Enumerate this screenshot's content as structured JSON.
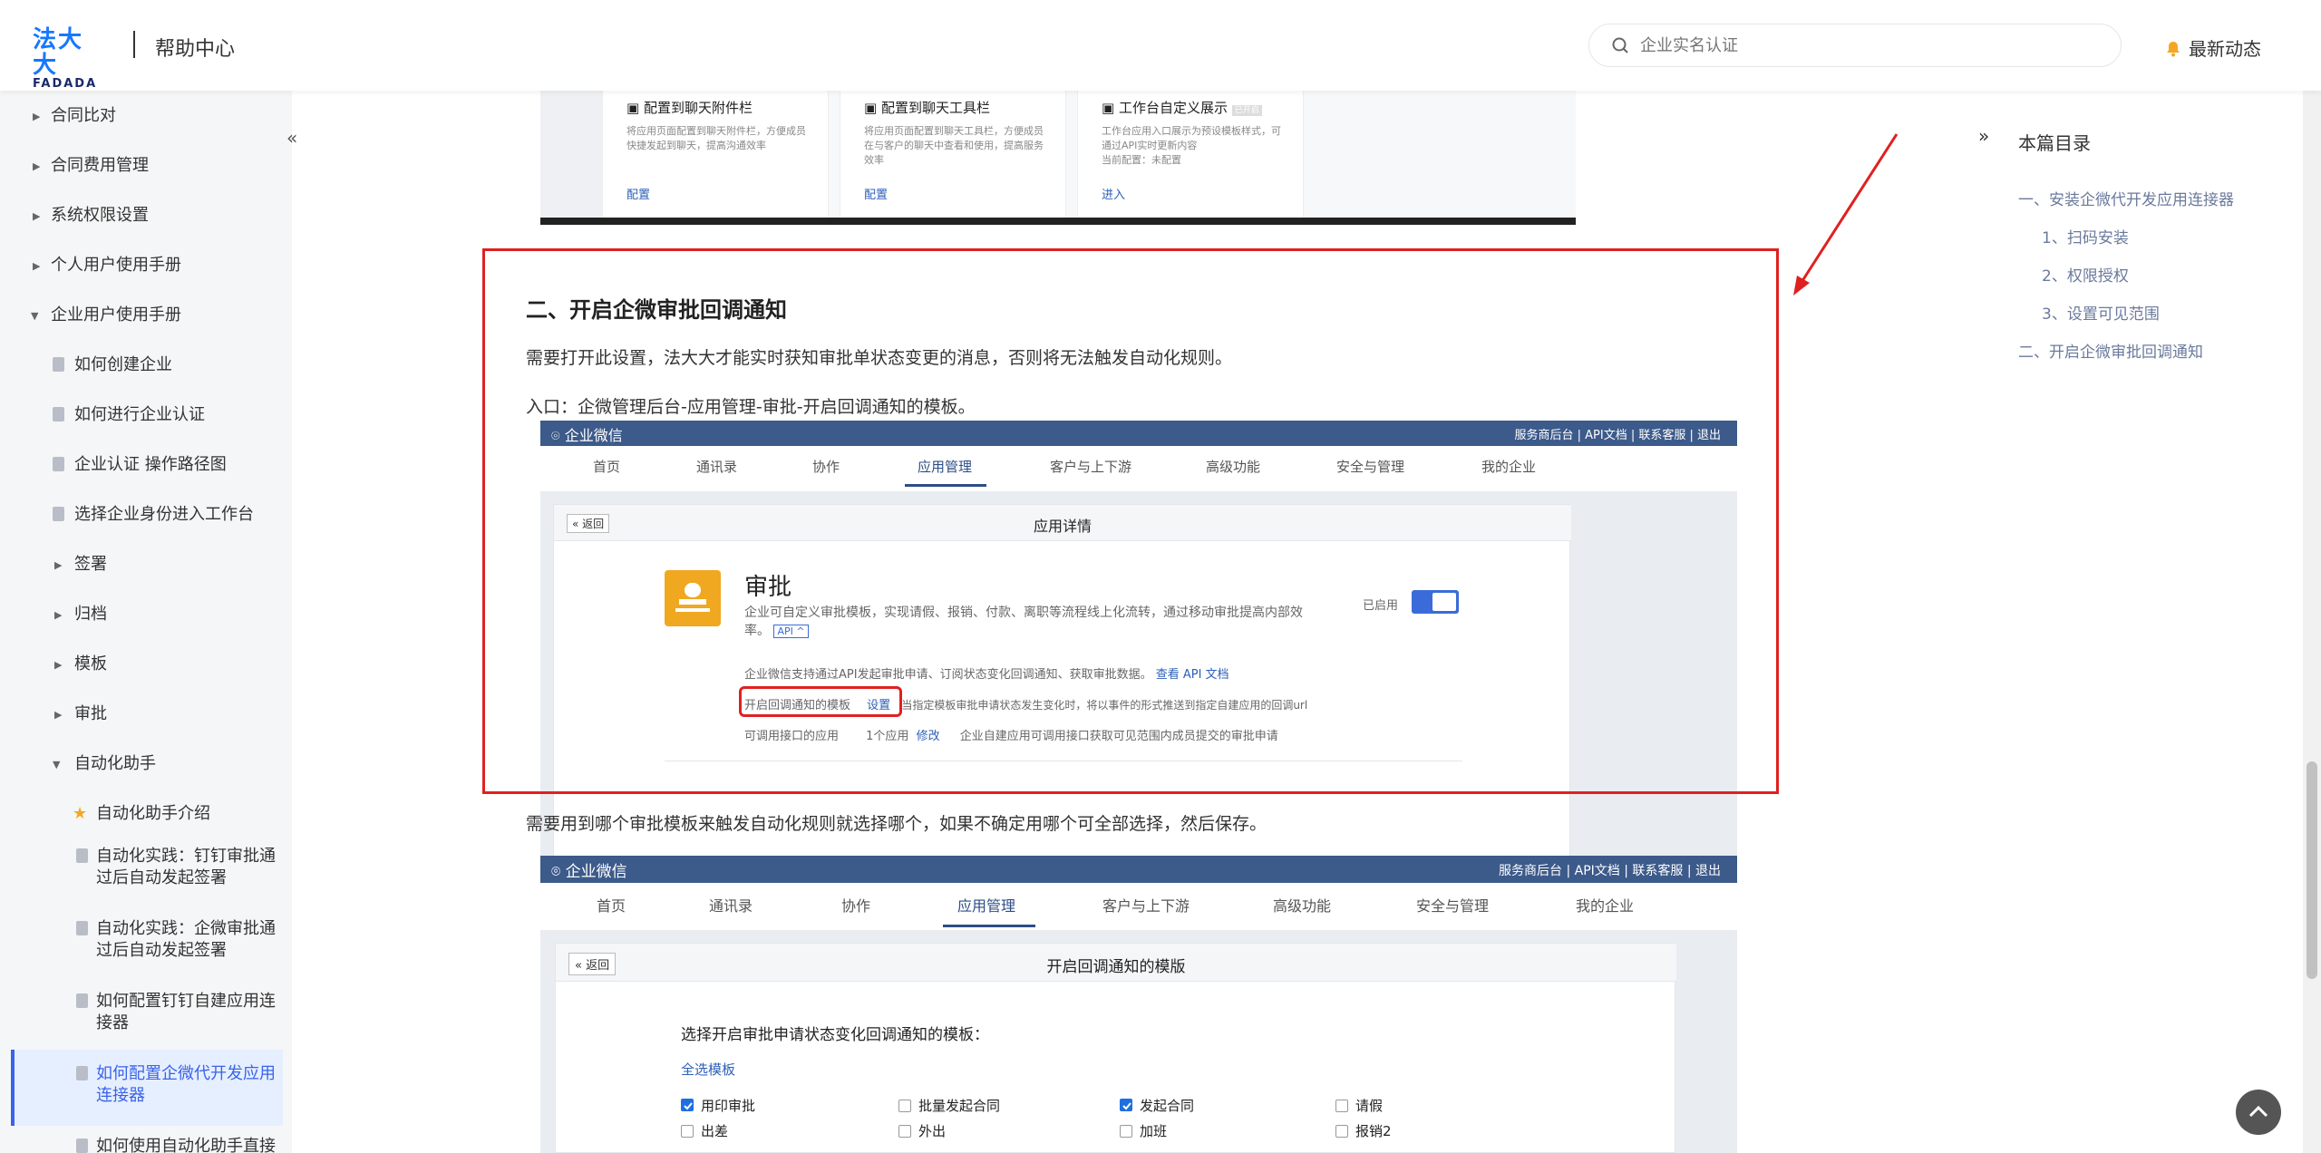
{
  "header": {
    "logo_cn": "法大大",
    "logo_en": "FADADA",
    "section": "帮助中心",
    "search_placeholder": "企业实名认证",
    "news": "最新动态"
  },
  "sidebar": {
    "items": [
      {
        "label": "合同比对",
        "type": "folder"
      },
      {
        "label": "合同费用管理",
        "type": "folder"
      },
      {
        "label": "系统权限设置",
        "type": "folder"
      },
      {
        "label": "个人用户使用手册",
        "type": "folder"
      },
      {
        "label": "企业用户使用手册",
        "type": "folder-open"
      },
      {
        "label": "如何创建企业",
        "type": "doc"
      },
      {
        "label": "如何进行企业认证",
        "type": "doc"
      },
      {
        "label": "企业认证 操作路径图",
        "type": "doc"
      },
      {
        "label": "选择企业身份进入工作台",
        "type": "doc"
      },
      {
        "label": "签署",
        "type": "sub-folder"
      },
      {
        "label": "归档",
        "type": "sub-folder"
      },
      {
        "label": "模板",
        "type": "sub-folder"
      },
      {
        "label": "审批",
        "type": "sub-folder"
      },
      {
        "label": "自动化助手",
        "type": "sub-folder-open"
      },
      {
        "label": "自动化助手介绍",
        "type": "star"
      },
      {
        "label1": "自动化实践：钉钉审批通",
        "label2": "过后自动发起签署",
        "type": "doc2"
      },
      {
        "label1": "自动化实践：企微审批通",
        "label2": "过后自动发起签署",
        "type": "doc2"
      },
      {
        "label1": "如何配置钉钉自建应用连",
        "label2": "接器",
        "type": "doc2"
      },
      {
        "label1": "如何配置企微代开发应用",
        "label2": "连接器",
        "type": "doc2-active"
      },
      {
        "label1": "如何使用自动化助手直接",
        "type": "doc2"
      }
    ]
  },
  "top_shot": {
    "cols": [
      {
        "title": "配置到聊天附件栏",
        "desc1": "将应用页面配置到聊天附件栏，方便成员",
        "desc2": "快捷发起到聊天，提高沟通效率",
        "action": "配置"
      },
      {
        "title": "配置到聊天工具栏",
        "desc1": "将应用页面配置到聊天工具栏，方便成员",
        "desc2": "在与客户的聊天中查看和使用，提高服务",
        "desc3": "效率",
        "action": "配置"
      },
      {
        "title": "工作台自定义展示",
        "badge": "已开启",
        "desc1": "工作台应用入口展示为预设模板样式，可",
        "desc2": "通过API实时更新内容",
        "desc3": "当前配置：未配置",
        "action": "进入"
      }
    ]
  },
  "article": {
    "h2": "二、开启企微审批回调通知",
    "p1": "需要打开此设置，法大大才能实时获知审批单状态变更的消息，否则将无法触发自动化规则。",
    "p2": "入口：企微管理后台-应用管理-审批-开启回调通知的模板。",
    "p3": "需要用到哪个审批模板来触发自动化规则就选择哪个，如果不确定用哪个可全部选择，然后保存。"
  },
  "wx": {
    "brand": "企业微信",
    "top_links": "服务商后台 | API文档 | 联系客服 | 退出",
    "nav": [
      "首页",
      "通讯录",
      "协作",
      "应用管理",
      "客户与上下游",
      "高级功能",
      "安全与管理",
      "我的企业"
    ],
    "back": "« 返回",
    "panel1_title": "应用详情",
    "app_name": "审批",
    "app_desc1": "企业可自定义审批模板，实现请假、报销、付款、离职等流程线上化流转，通过移动审批提高内部效",
    "app_desc2": "率。",
    "api_tag": "API ^",
    "enabled": "已启用",
    "support_text": "企业微信支持通过API发起审批申请、订阅状态变化回调通知、获取审批数据。",
    "api_link": "查看 API 文档",
    "callback_label": "开启回调通知的模板",
    "callback_set": "设置",
    "callback_desc": "当指定模板审批申请状态发生变化时，将以事件的形式推送到指定自建应用的回调url",
    "callable_label": "可调用接口的应用",
    "callable_count": "1个应用",
    "callable_edit": "修改",
    "callable_desc": "企业自建应用可调用接口获取可见范围内成员提交的审批申请",
    "panel2_title": "开启回调通知的模版",
    "select_title": "选择开启审批申请状态变化回调通知的模板：",
    "select_all": "全选模板",
    "templates": [
      {
        "label": "用印审批",
        "checked": true
      },
      {
        "label": "批量发起合同",
        "checked": false
      },
      {
        "label": "发起合同",
        "checked": true
      },
      {
        "label": "请假",
        "checked": false
      },
      {
        "label": "出差",
        "checked": false
      },
      {
        "label": "外出",
        "checked": false
      },
      {
        "label": "加班",
        "checked": false
      },
      {
        "label": "报销2",
        "checked": false
      }
    ]
  },
  "toc": {
    "title": "本篇目录",
    "items": [
      "一、安装企微代开发应用连接器",
      "1、扫码安装",
      "2、权限授权",
      "3、设置可见范围",
      "二、开启企微审批回调通知"
    ]
  }
}
